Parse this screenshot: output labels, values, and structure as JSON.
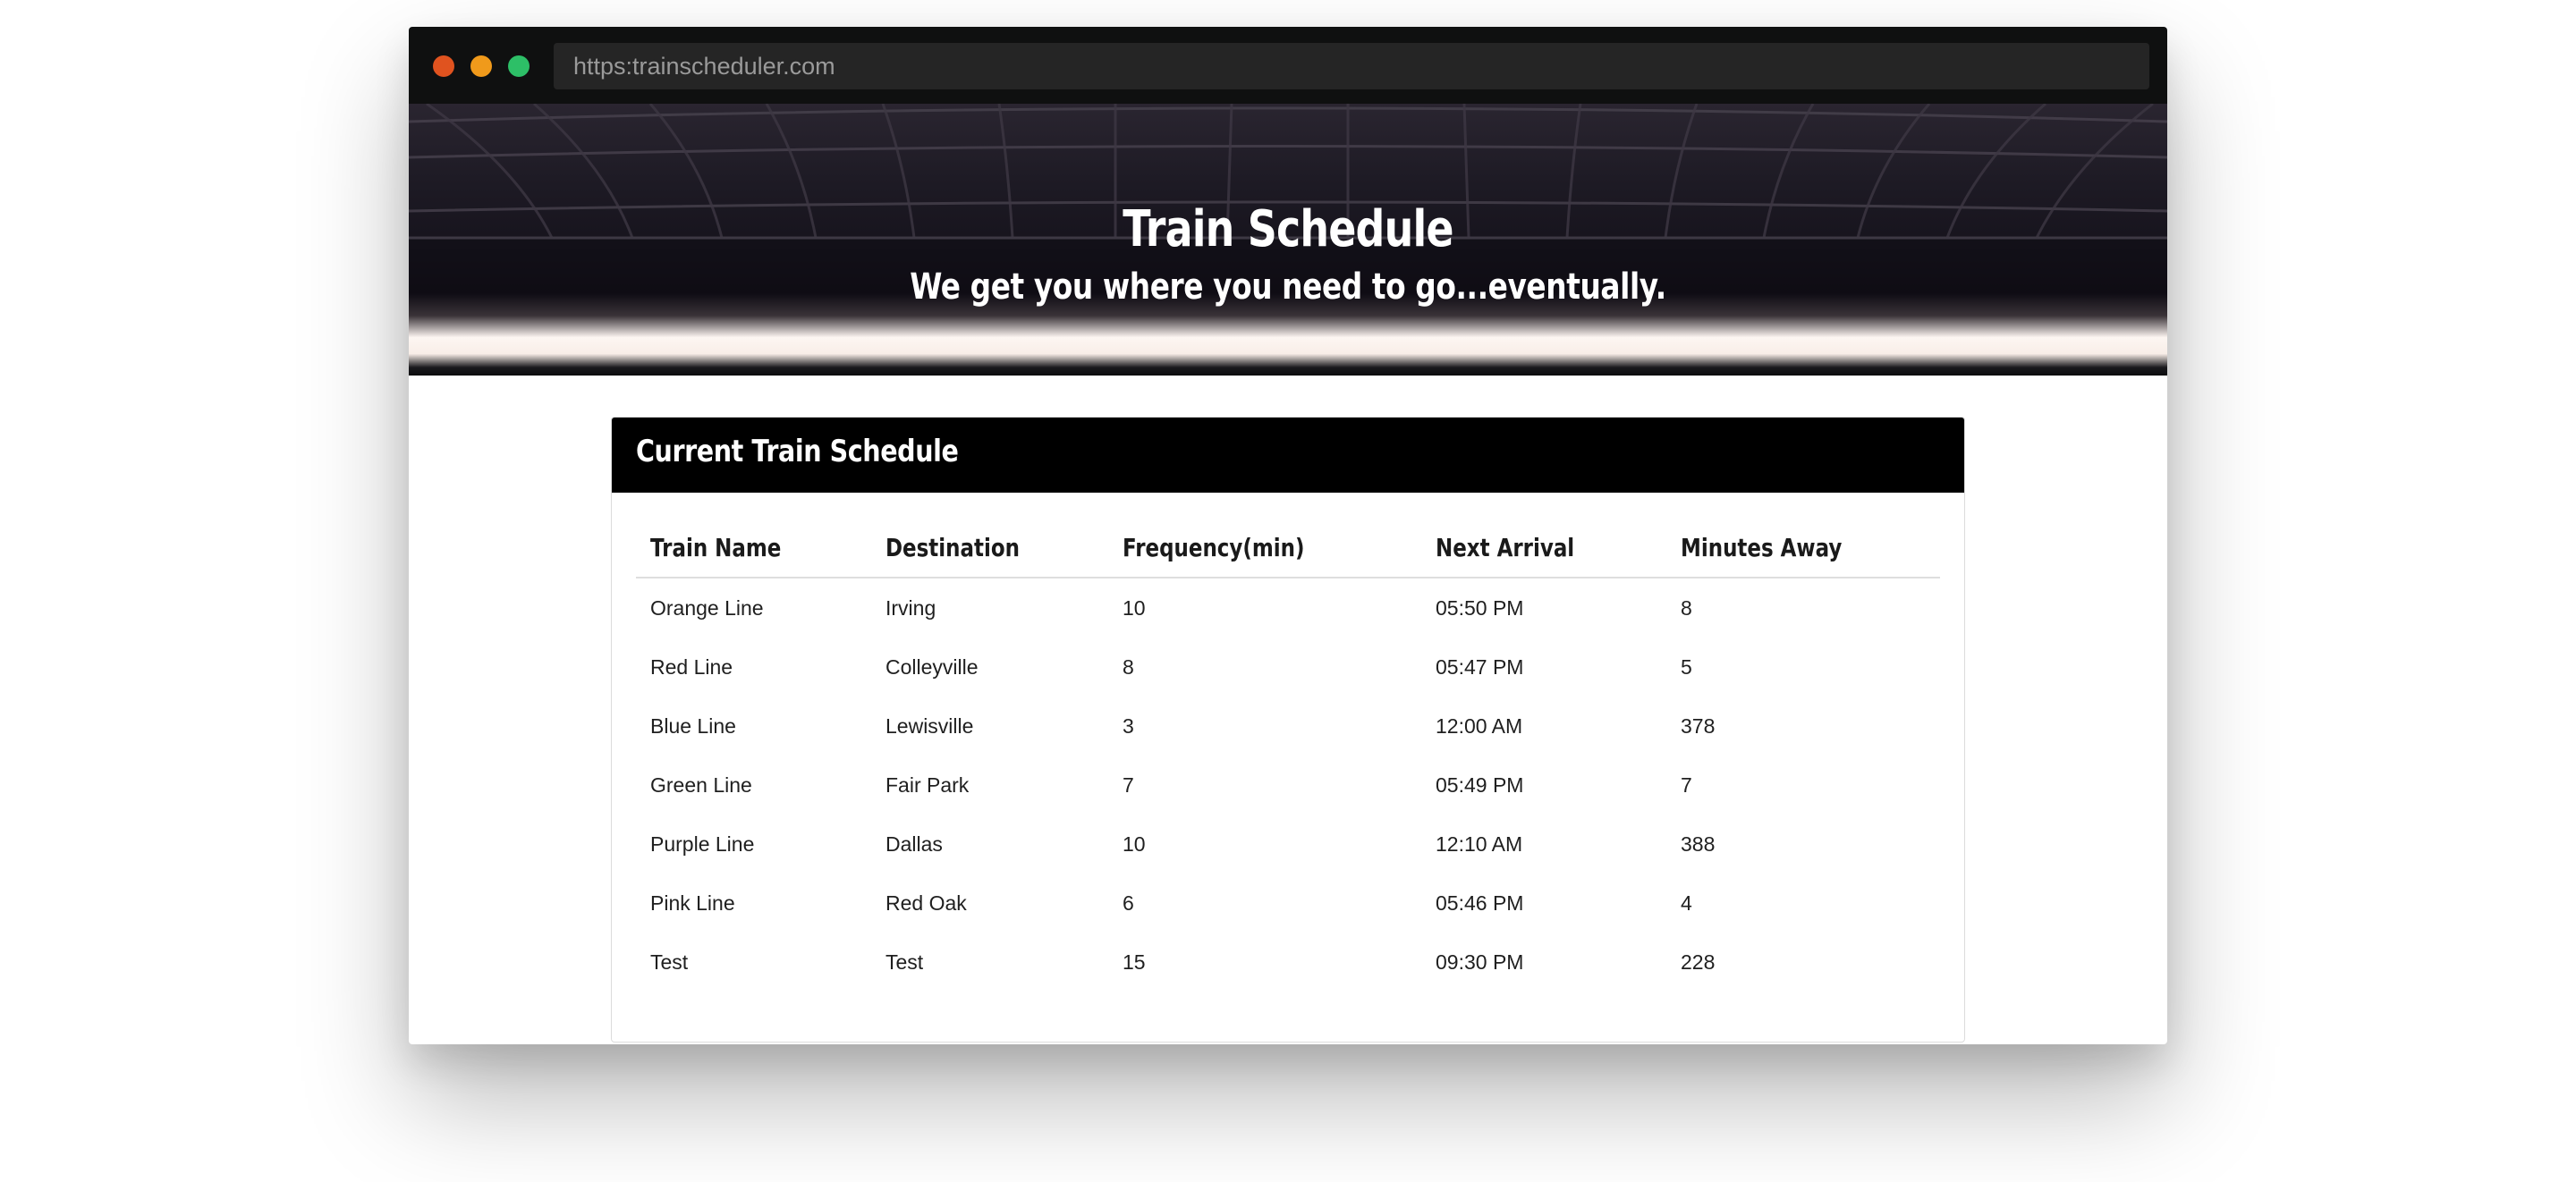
{
  "browser": {
    "url": "https:trainscheduler.com"
  },
  "hero": {
    "title": "Train Schedule",
    "subtitle": "We get you where you need to go...eventually."
  },
  "schedule": {
    "heading": "Current Train Schedule",
    "columns": [
      "Train Name",
      "Destination",
      "Frequency(min)",
      "Next Arrival",
      "Minutes Away"
    ],
    "rows": [
      [
        "Orange Line",
        "Irving",
        "10",
        "05:50 PM",
        "8"
      ],
      [
        "Red Line",
        "Colleyville",
        "8",
        "05:47 PM",
        "5"
      ],
      [
        "Blue Line",
        "Lewisville",
        "3",
        "12:00 AM",
        "378"
      ],
      [
        "Green Line",
        "Fair Park",
        "7",
        "05:49 PM",
        "7"
      ],
      [
        "Purple Line",
        "Dallas",
        "10",
        "12:10 AM",
        "388"
      ],
      [
        "Pink Line",
        "Red Oak",
        "6",
        "05:46 PM",
        "4"
      ],
      [
        "Test",
        "Test",
        "15",
        "09:30 PM",
        "228"
      ]
    ]
  },
  "colors": {
    "window_close": "#e0531f",
    "window_minimize": "#f09a1b",
    "window_maximize": "#2dbf67",
    "panel_heading_bg": "#000000"
  }
}
